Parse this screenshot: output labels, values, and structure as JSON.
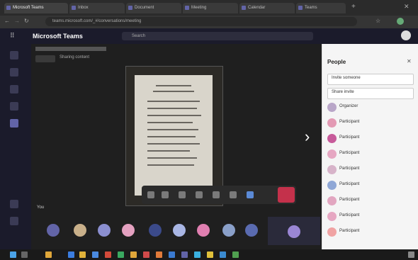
{
  "browser": {
    "tabs": [
      {
        "label": "Microsoft Teams"
      },
      {
        "label": "Inbox"
      },
      {
        "label": "Document"
      },
      {
        "label": "Meeting"
      },
      {
        "label": "Calendar"
      },
      {
        "label": "Teams"
      }
    ],
    "url": "teams.microsoft.com/_#/conversations/meeting"
  },
  "app": {
    "title": "Microsoft Teams",
    "search_placeholder": "Search"
  },
  "meeting": {
    "banner": "Sharing content",
    "self_label": "You"
  },
  "people_panel": {
    "title": "People",
    "rows": [
      {
        "name": "Invite someone",
        "side": ""
      },
      {
        "name": "Share invite",
        "side": ""
      },
      {
        "name": "Organizer",
        "side": ""
      },
      {
        "name": "Participant",
        "side": ""
      },
      {
        "name": "Participant",
        "side": ""
      },
      {
        "name": "Participant",
        "side": ""
      },
      {
        "name": "Participant",
        "side": ""
      },
      {
        "name": "Participant",
        "side": ""
      },
      {
        "name": "Participant",
        "side": ""
      },
      {
        "name": "Participant",
        "side": ""
      },
      {
        "name": "Participant",
        "side": ""
      }
    ]
  },
  "taskbar": {
    "time": ""
  },
  "colors": {
    "brand": "#6264a7",
    "leave": "#c4314b",
    "panel_bg": "#f5f5f5"
  }
}
